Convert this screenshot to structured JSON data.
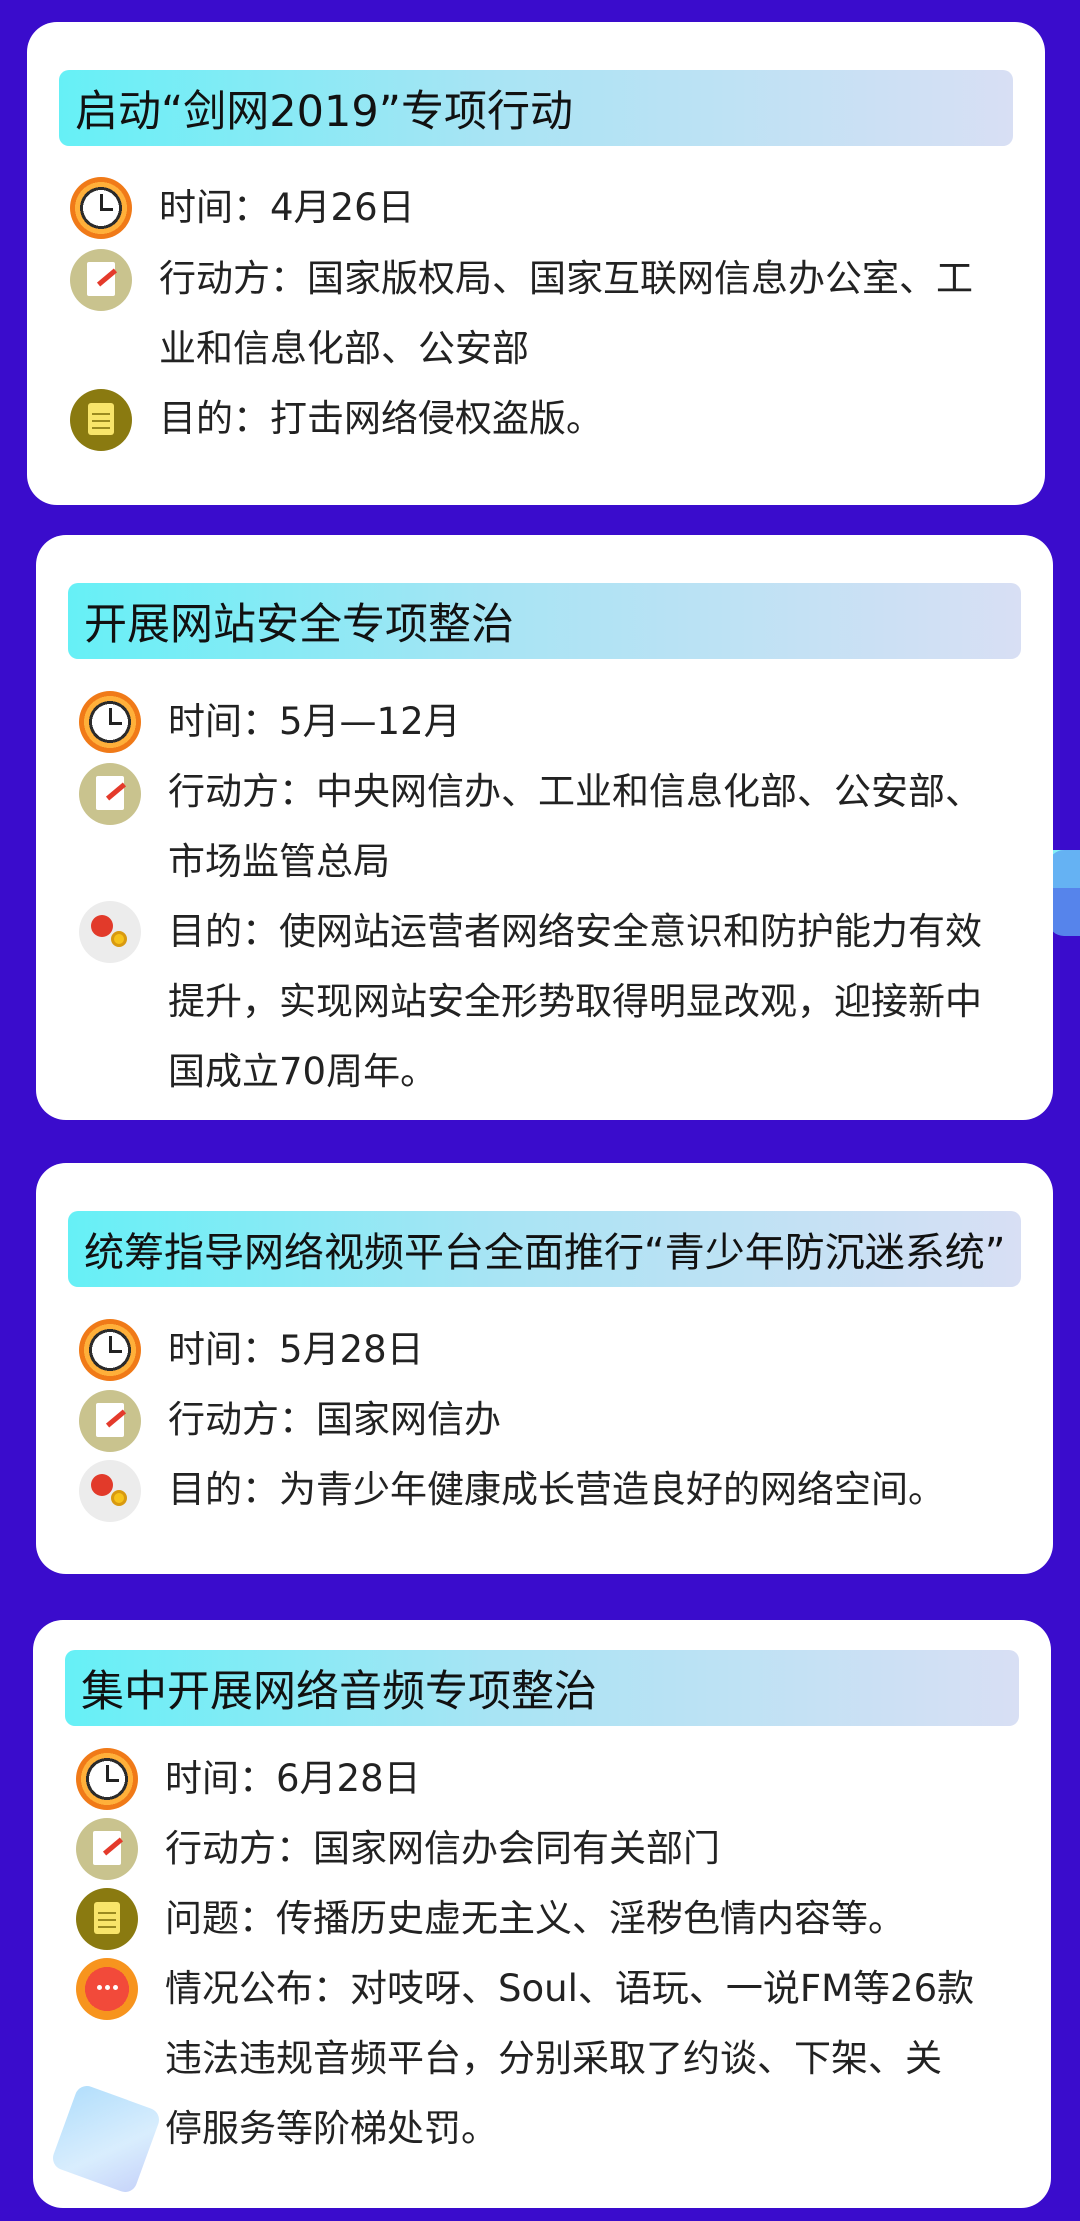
{
  "sections": [
    {
      "title": "启动“剑网2019”专项行动",
      "items": [
        {
          "icon": "clock-icon",
          "lines": [
            "时间：4月26日"
          ]
        },
        {
          "icon": "document-pen-icon",
          "lines": [
            "行动方：国家版权局、国家互联网信息办公室、工",
            "业和信息化部、公安部"
          ]
        },
        {
          "icon": "notepad-icon",
          "lines": [
            "目的：打击网络侵权盗版。"
          ]
        }
      ]
    },
    {
      "title": "开展网站安全专项整治",
      "items": [
        {
          "icon": "clock-icon",
          "lines": [
            "时间：5月—12月"
          ]
        },
        {
          "icon": "document-pen-icon",
          "lines": [
            "行动方：中央网信办、工业和信息化部、公安部、",
            "市场监管总局"
          ]
        },
        {
          "icon": "gears-icon",
          "lines": [
            "目的：使网站运营者网络安全意识和防护能力有效",
            "提升，实现网站安全形势取得明显改观，迎接新中",
            "国成立70周年。"
          ]
        }
      ]
    },
    {
      "title": "统筹指导网络视频平台全面推行“青少年防沉迷系统”",
      "items": [
        {
          "icon": "clock-icon",
          "lines": [
            "时间：5月28日"
          ]
        },
        {
          "icon": "document-pen-icon",
          "lines": [
            "行动方：国家网信办"
          ]
        },
        {
          "icon": "gears-icon",
          "lines": [
            "目的：为青少年健康成长营造良好的网络空间。"
          ]
        }
      ]
    },
    {
      "title": "集中开展网络音频专项整治",
      "items": [
        {
          "icon": "clock-icon",
          "lines": [
            "时间：6月28日"
          ]
        },
        {
          "icon": "document-pen-icon",
          "lines": [
            "行动方：国家网信办会同有关部门"
          ]
        },
        {
          "icon": "notepad-icon",
          "lines": [
            "问题：传播历史虚无主义、淫秽色情内容等。"
          ]
        },
        {
          "icon": "chat-bubble-icon",
          "lines": [
            "情况公布：对吱呀、Soul、语玩、一说FM等26款",
            "违法违规音频平台，分别采取了约谈、下架、关",
            "停服务等阶梯处罚。"
          ]
        }
      ]
    }
  ]
}
